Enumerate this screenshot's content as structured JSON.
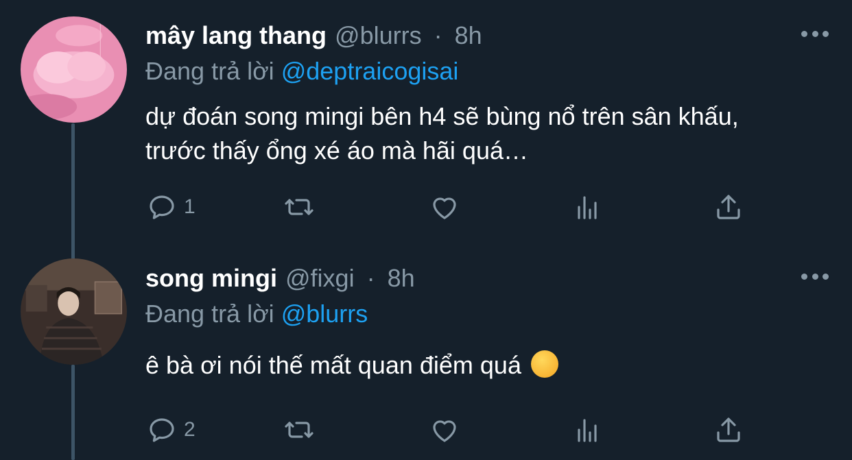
{
  "colors": {
    "background": "#15202b",
    "secondary_text": "#8899a6",
    "link": "#1da1f2",
    "thread_line": "#3d5466"
  },
  "tweets": [
    {
      "display_name": "mây lang thang",
      "handle": "@blurrs",
      "separator": "·",
      "time": "8h",
      "reply_prefix": "Đang trả lời",
      "reply_to": "@deptraicogisai",
      "text": "dự đoán song mingi bên h4 sẽ bùng nổ trên sân khấu, trước thấy ổng xé áo mà hãi quá…",
      "actions": {
        "reply_count": "1",
        "retweet_count": "",
        "like_count": ""
      },
      "avatar_icon": "pink-cloud-avatar"
    },
    {
      "display_name": "song mingi",
      "handle": "@fixgi",
      "separator": "·",
      "time": "8h",
      "reply_prefix": "Đang trả lời",
      "reply_to": "@blurrs",
      "text": "ê bà ơi nói thế mất quan điểm quá",
      "emoji": "melting-face-emoji",
      "actions": {
        "reply_count": "2",
        "retweet_count": "",
        "like_count": ""
      },
      "avatar_icon": "person-photo-avatar"
    }
  ],
  "icons": {
    "reply": "reply-icon",
    "retweet": "retweet-icon",
    "like": "heart-icon",
    "analytics": "analytics-icon",
    "share": "share-icon",
    "more": "more-icon"
  }
}
